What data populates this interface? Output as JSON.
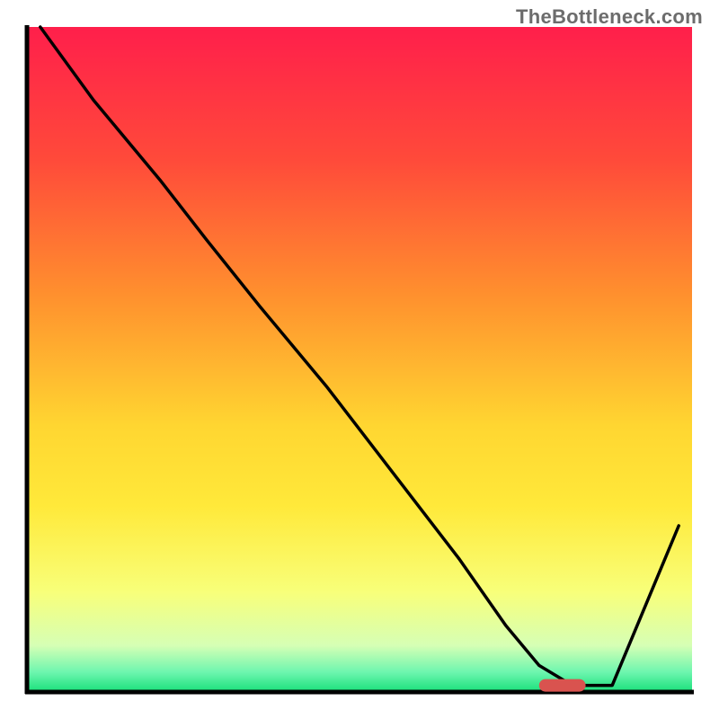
{
  "attribution": "TheBottleneck.com",
  "chart_data": {
    "type": "line",
    "title": "",
    "xlabel": "",
    "ylabel": "",
    "xlim": [
      0,
      100
    ],
    "ylim": [
      0,
      100
    ],
    "x": [
      2,
      10,
      20,
      27,
      35,
      45,
      55,
      65,
      72,
      77,
      82,
      88,
      98
    ],
    "values": [
      100,
      89,
      77,
      68,
      58,
      46,
      33,
      20,
      10,
      4,
      1,
      1,
      25
    ],
    "background_gradient": {
      "stops": [
        {
          "pos": 0.0,
          "color": "#ff1f4b"
        },
        {
          "pos": 0.2,
          "color": "#ff4a3a"
        },
        {
          "pos": 0.4,
          "color": "#ff8f2e"
        },
        {
          "pos": 0.6,
          "color": "#ffd631"
        },
        {
          "pos": 0.72,
          "color": "#ffe93a"
        },
        {
          "pos": 0.85,
          "color": "#f8ff7a"
        },
        {
          "pos": 0.93,
          "color": "#d6ffb5"
        },
        {
          "pos": 0.97,
          "color": "#6ef6af"
        },
        {
          "pos": 1.0,
          "color": "#18e07a"
        }
      ]
    },
    "marker": {
      "x_start": 77,
      "x_end": 84,
      "y": 1,
      "color": "#d9534f"
    }
  },
  "plot": {
    "outer_w": 800,
    "outer_h": 800,
    "inner_x": 30,
    "inner_y": 30,
    "inner_w": 740,
    "inner_h": 740
  }
}
